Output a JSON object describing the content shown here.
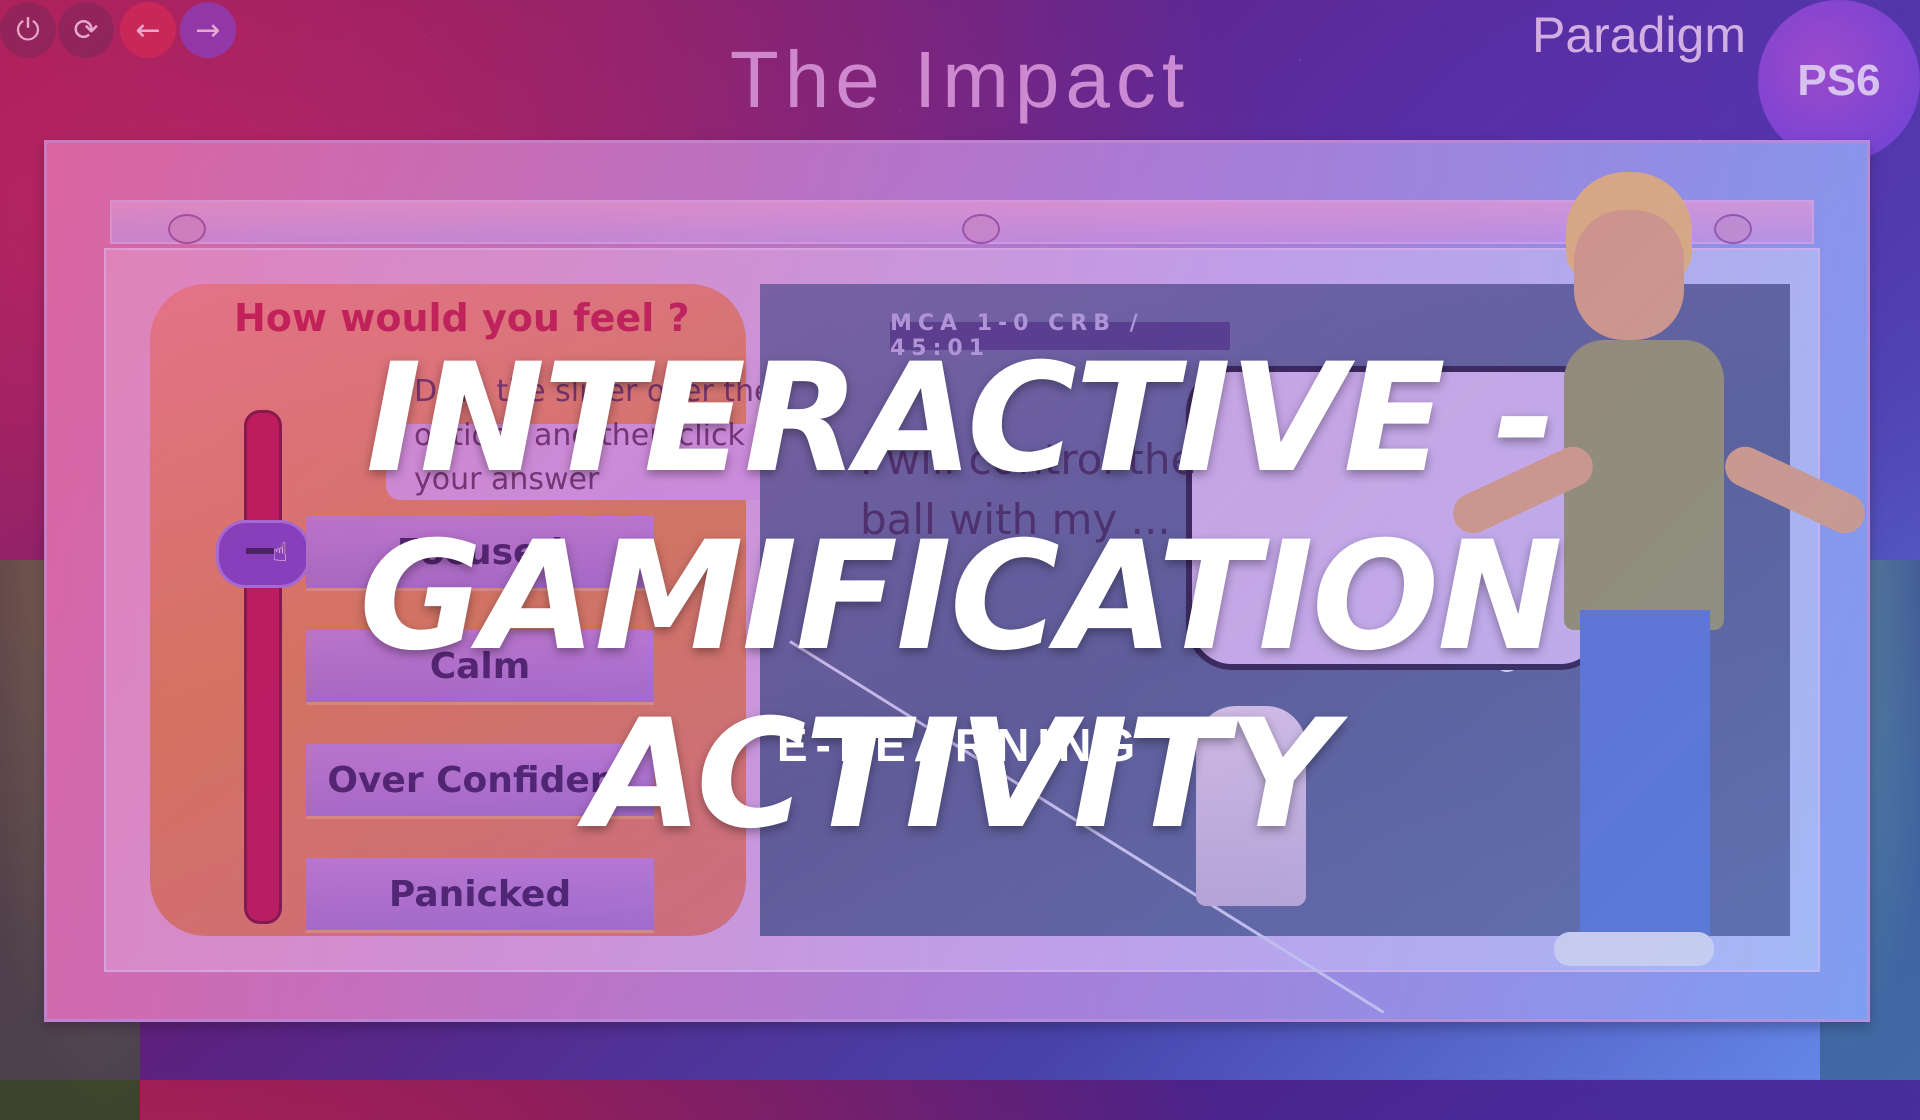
{
  "header": {
    "title": "The Impact",
    "brand": "Paradigm",
    "badge": "PS6"
  },
  "controls": {
    "power_icon": "power-icon",
    "reload_icon": "reload-icon",
    "back_icon": "back-arrow-icon",
    "next_icon": "next-arrow-icon"
  },
  "activity": {
    "question": "How would you feel ?",
    "instruction": "Drag the slider over the options and then click on your answer",
    "options": [
      "Focused",
      "Calm",
      "Over Confident",
      "Panicked"
    ],
    "selected": "Focused"
  },
  "video": {
    "scoreboard": "MCA 1-0 CRB / 45:01",
    "speech": "I will control the ball with my ..."
  },
  "overlay": {
    "headline_line1": "Interactive - Gamification",
    "headline_line2": "Activity",
    "subheadline": "E-LEARNING"
  },
  "colors": {
    "accent_red": "#c41e48",
    "accent_purple": "#7b43c6",
    "badge": "#a548c8"
  }
}
